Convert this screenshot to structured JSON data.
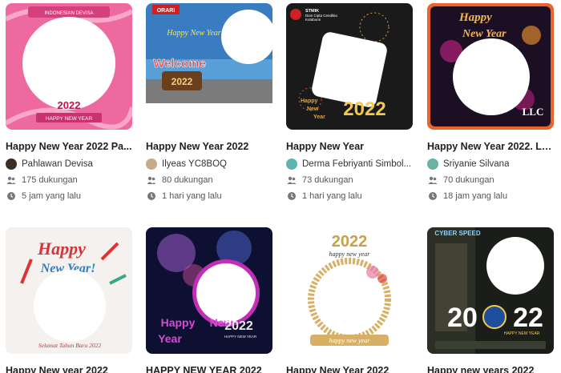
{
  "cards": [
    {
      "title": "Happy New Year 2022 Pa...",
      "author": "Pahlawan Devisa",
      "supporters": "175 dukungan",
      "time": "5 jam yang lalu",
      "art_text": [
        "INDONESIAN DEVISA",
        "2022",
        "HAPPY NEW YEAR"
      ],
      "avatar_color": "#3a2f25"
    },
    {
      "title": "Happy New Year 2022",
      "author": "Ilyeas YC8BOQ",
      "supporters": "80 dukungan",
      "time": "1 hari yang lalu",
      "art_text": [
        "ORARI",
        "Happy New Year",
        "Welcome",
        "2022"
      ],
      "avatar_color": "#c9a98e"
    },
    {
      "title": "Happy New Year",
      "author": "Derma Febriyanti Simbol...",
      "supporters": "73 dukungan",
      "time": "1 hari yang lalu",
      "art_text": [
        "STMIK",
        "Dian Cipta Cendikia",
        "Kotabumi",
        "Happy",
        "New",
        "Year",
        "2022"
      ],
      "avatar_color": "#5fb4b0"
    },
    {
      "title": "Happy New Year 2022. LL...",
      "author": "Sriyanie Silvana",
      "supporters": "70 dukungan",
      "time": "18 jam yang lalu",
      "art_text": [
        "Happy",
        "New Year",
        "LLC"
      ],
      "avatar_color": "#6ab3a4"
    },
    {
      "title": "Happy New year 2022",
      "art_text": [
        "Happy",
        "New Year!",
        "Selamat Tahun Baru 2022"
      ]
    },
    {
      "title": "HAPPY NEW YEAR 2022",
      "art_text": [
        "Happy",
        "New",
        "Year",
        "2022",
        "HAPPY NEW YEAR"
      ]
    },
    {
      "title": "Happy New Year 2022",
      "art_text": [
        "2022",
        "happy new year",
        "happy new year"
      ]
    },
    {
      "title": "Happy new years 2022",
      "art_text": [
        "CYBER SPEED",
        "20",
        "22",
        "HAPPY NEW YEAR"
      ]
    }
  ],
  "icons": {
    "supporters": "people-icon",
    "time": "clock-icon"
  },
  "colors": {
    "card1_bg": "#ec5f9a",
    "card4_accent": "#e8642c",
    "title_text": "#1f1f1f",
    "meta_text": "#555555"
  }
}
